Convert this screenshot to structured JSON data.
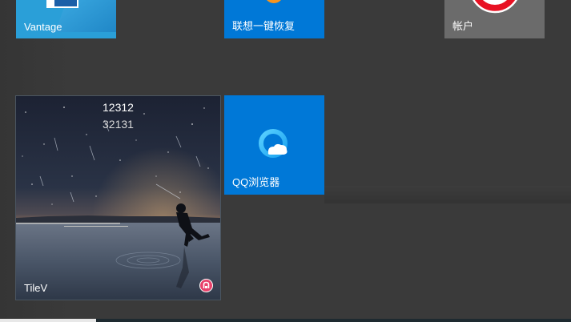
{
  "tiles": {
    "vantage": {
      "label": "Vantage",
      "color": "#2a9fd8"
    },
    "recovery": {
      "label": "联想一键恢复",
      "color": "#0078d7"
    },
    "account": {
      "label": "帐户",
      "color": "#6b6b6b"
    },
    "tilev": {
      "label": "TileV",
      "line1": "12312",
      "line2": "32131"
    },
    "qq_browser": {
      "label": "QQ浏览器",
      "color": "#0078d7",
      "icon": "qq-browser-icon"
    }
  },
  "colors": {
    "background": "#3a3a3a",
    "tile_blue": "#0078d7",
    "account_red": "#e81123"
  }
}
